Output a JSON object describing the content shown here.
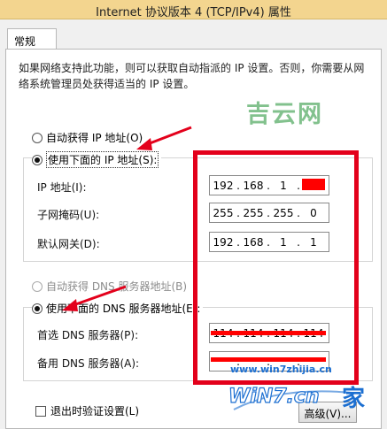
{
  "window": {
    "title": "Internet 协议版本 4 (TCP/IPv4) 属性"
  },
  "tabs": [
    {
      "label": "常规"
    }
  ],
  "description": "如果网络支持此功能，则可以获取自动指派的 IP 设置。否则，你需要从网络系统管理员处获得适当的 IP 设置。",
  "ip": {
    "auto_label": "自动获得 IP 地址(O)",
    "manual_label": "使用下面的 IP 地址(S):",
    "selected": "manual",
    "fields": [
      {
        "label": "IP 地址(I):",
        "octets": [
          "192",
          "168",
          "1",
          ""
        ]
      },
      {
        "label": "子网掩码(U):",
        "octets": [
          "255",
          "255",
          "255",
          "0"
        ]
      },
      {
        "label": "默认网关(D):",
        "octets": [
          "192",
          "168",
          "1",
          "1"
        ]
      }
    ]
  },
  "dns": {
    "auto_label": "自动获得 DNS 服务器地址(B)",
    "manual_label": "使用下面的 DNS 服务器地址(E):",
    "selected": "manual",
    "fields": [
      {
        "label": "首选 DNS 服务器(P):",
        "octets": [
          "114",
          "114",
          "114",
          "114"
        ]
      },
      {
        "label": "备用 DNS 服务器(A):",
        "octets": [
          "",
          "",
          "",
          ""
        ]
      }
    ]
  },
  "validate_on_exit": {
    "label": "退出时验证设置(L)",
    "checked": false
  },
  "advanced_button": "高级(V)...",
  "watermark": {
    "site_cn": "吉云网",
    "url": "www.win7zhijia.cn",
    "logo_text": "WiN7.cn",
    "logo_char": "家"
  },
  "colors": {
    "titlebar": "#f3d58f",
    "highlight_red": "#e3001b",
    "watermark_green": "#6db77a",
    "watermark_blue": "#1c6fd1"
  }
}
